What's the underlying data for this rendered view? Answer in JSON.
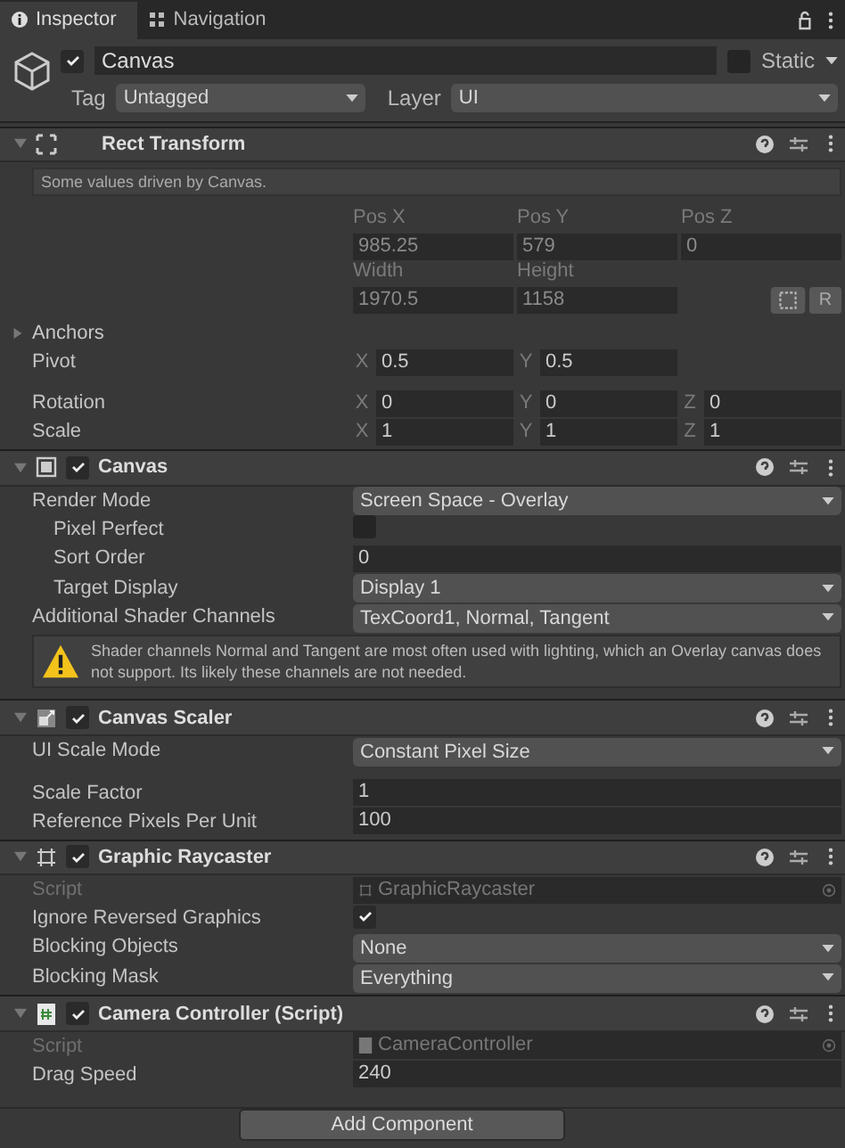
{
  "tabs": [
    {
      "label": "Inspector",
      "selected": true
    },
    {
      "label": "Navigation",
      "selected": false
    }
  ],
  "object": {
    "active": true,
    "name": "Canvas",
    "static_label": "Static",
    "static": false,
    "tag_label": "Tag",
    "tag": "Untagged",
    "layer_label": "Layer",
    "layer": "UI"
  },
  "rect_transform": {
    "title": "Rect Transform",
    "expanded": true,
    "note": "Some values driven by Canvas.",
    "position": [
      {
        "label": "Pos X",
        "value": "985.25"
      },
      {
        "label": "Pos Y",
        "value": "579"
      },
      {
        "label": "Pos Z",
        "value": "0"
      }
    ],
    "size": [
      {
        "label": "Width",
        "value": "1970.5"
      },
      {
        "label": "Height",
        "value": "1158"
      }
    ],
    "raw_button": "R",
    "anchors": {
      "label": "Anchors",
      "expanded": false
    },
    "vectors": [
      {
        "label": "Pivot",
        "fields": [
          {
            "axis": "X",
            "value": "0.5"
          },
          {
            "axis": "Y",
            "value": "0.5"
          }
        ]
      },
      {
        "label": "Rotation",
        "fields": [
          {
            "axis": "X",
            "value": "0"
          },
          {
            "axis": "Y",
            "value": "0"
          },
          {
            "axis": "Z",
            "value": "0"
          }
        ]
      },
      {
        "label": "Scale",
        "fields": [
          {
            "axis": "X",
            "value": "1"
          },
          {
            "axis": "Y",
            "value": "1"
          },
          {
            "axis": "Z",
            "value": "1"
          }
        ]
      }
    ]
  },
  "components": [
    {
      "title": "Canvas",
      "enabled": true,
      "expanded": true,
      "rows": [
        {
          "kind": "dropdown",
          "label": "Render Mode",
          "value": "Screen Space - Overlay",
          "children": [
            {
              "kind": "checkbox",
              "label": "Pixel Perfect",
              "checked": false
            },
            {
              "kind": "field",
              "label": "Sort Order",
              "value": "0"
            },
            {
              "kind": "dropdown",
              "label": "Target Display",
              "value": "Display 1"
            }
          ]
        },
        {
          "kind": "dropdown",
          "label": "Additional Shader Channels",
          "value": "TexCoord1, Normal, Tangent"
        }
      ],
      "warning": "Shader channels Normal and Tangent are most often used with lighting, which an Overlay canvas does not support. Its likely these channels are not needed."
    },
    {
      "title": "Canvas Scaler",
      "enabled": true,
      "expanded": true,
      "rows": [
        {
          "kind": "dropdown",
          "label": "UI Scale Mode",
          "value": "Constant Pixel Size",
          "gap_after": true
        },
        {
          "kind": "field",
          "label": "Scale Factor",
          "value": "1"
        },
        {
          "kind": "field",
          "label": "Reference Pixels Per Unit",
          "value": "100"
        }
      ]
    },
    {
      "title": "Graphic Raycaster",
      "enabled": true,
      "expanded": true,
      "rows": [
        {
          "kind": "object",
          "label": "Script",
          "value": "GraphicRaycaster"
        },
        {
          "kind": "checkbox",
          "label": "Ignore Reversed Graphics",
          "checked": true
        },
        {
          "kind": "dropdown",
          "label": "Blocking Objects",
          "value": "None"
        },
        {
          "kind": "dropdown",
          "label": "Blocking Mask",
          "value": "Everything"
        }
      ]
    },
    {
      "title": "Camera Controller (Script)",
      "enabled": true,
      "expanded": true,
      "rows": [
        {
          "kind": "object",
          "label": "Script",
          "value": "CameraController"
        },
        {
          "kind": "field",
          "label": "Drag Speed",
          "value": "240"
        }
      ]
    }
  ],
  "add_button": "Add Component"
}
